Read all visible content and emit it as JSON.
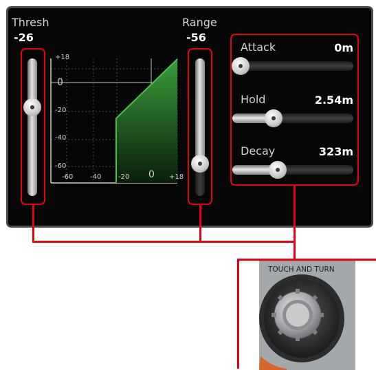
{
  "threshold": {
    "label": "Thresh",
    "value": "-26",
    "level": 0.58
  },
  "range": {
    "label": "Range",
    "value": "-56",
    "level": 0.25
  },
  "graph": {
    "y_ticks": [
      "+18",
      "0",
      "-20",
      "-40",
      "-60"
    ],
    "x_ticks": [
      "-60",
      "-40",
      "-20",
      "0",
      "+18"
    ]
  },
  "attack": {
    "label": "Attack",
    "value": "0m",
    "level": 0.0
  },
  "hold": {
    "label": "Hold",
    "value": "2.54m",
    "level": 0.3
  },
  "decay": {
    "label": "Decay",
    "value": "323m",
    "level": 0.34
  },
  "touch_and_turn": {
    "label": "TOUCH AND TURN",
    "icon": "rotary-knob-icon"
  },
  "colors": {
    "highlight": "#e60012",
    "graph_line": "#4bc04b",
    "panel_bg": "#060606"
  }
}
